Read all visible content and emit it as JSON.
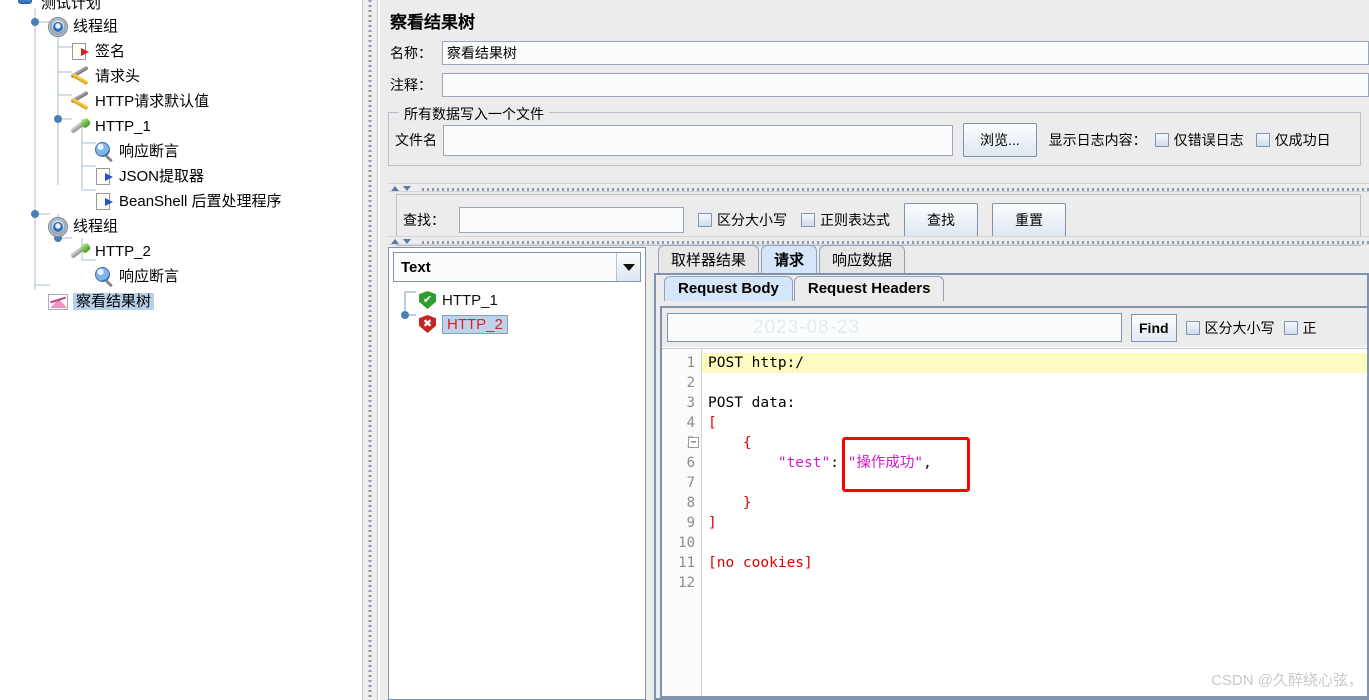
{
  "tree": {
    "name": "test-plan-tree",
    "nodes": [
      {
        "label": "测试计划",
        "icon": "test-plan-icon",
        "indent": 0,
        "selected": false,
        "clipped": true
      },
      {
        "label": "线程组",
        "icon": "thread-group-gear-icon",
        "indent": 1,
        "selected": false
      },
      {
        "label": "签名",
        "icon": "document-red-arrow-icon",
        "indent": 2,
        "selected": false
      },
      {
        "label": "请求头",
        "icon": "config-tools-icon",
        "indent": 2,
        "selected": false
      },
      {
        "label": "HTTP请求默认值",
        "icon": "config-tools-icon",
        "indent": 2,
        "selected": false
      },
      {
        "label": "HTTP_1",
        "icon": "http-sampler-icon",
        "indent": 2,
        "selected": false
      },
      {
        "label": "响应断言",
        "icon": "assertion-magnifier-icon",
        "indent": 3,
        "selected": false
      },
      {
        "label": "JSON提取器",
        "icon": "document-blue-arrow-icon",
        "indent": 3,
        "selected": false
      },
      {
        "label": "BeanShell 后置处理程序",
        "icon": "document-blue-arrow-icon",
        "indent": 3,
        "selected": false
      },
      {
        "label": "线程组",
        "icon": "thread-group-gear-icon",
        "indent": 1,
        "selected": false
      },
      {
        "label": "HTTP_2",
        "icon": "http-sampler-icon",
        "indent": 2,
        "selected": false
      },
      {
        "label": "响应断言",
        "icon": "assertion-magnifier-icon",
        "indent": 3,
        "selected": false
      },
      {
        "label": "察看结果树",
        "icon": "view-results-tree-icon",
        "indent": 1,
        "selected": true
      }
    ]
  },
  "main": {
    "title": "察看结果树",
    "name_label": "名称：",
    "name_value": "察看结果树",
    "comment_label": "注释：",
    "comment_value": "",
    "file_group": {
      "title": "所有数据写入一个文件",
      "filename_label": "文件名",
      "filename_value": "",
      "browse_label": "浏览...",
      "log_display_label": "显示日志内容：",
      "checkbox_errors_only": "仅错误日志",
      "checkbox_success_only": "仅成功日"
    },
    "search_strip": {
      "find_label": "查找：",
      "find_value": "",
      "checkbox_case": "区分大小写",
      "checkbox_regex": "正则表达式",
      "find_button": "查找",
      "reset_button": "重置"
    }
  },
  "results": {
    "renderer_selected": "Text",
    "items": [
      {
        "label": "HTTP_1",
        "status": "success",
        "status_glyph": "✔",
        "selected": false
      },
      {
        "label": "HTTP_2",
        "status": "error",
        "status_glyph": "✖",
        "selected": true
      }
    ]
  },
  "detail": {
    "tabs": [
      {
        "label": "取样器结果",
        "active": false
      },
      {
        "label": "请求",
        "active": true
      },
      {
        "label": "响应数据",
        "active": false
      }
    ],
    "subtabs": [
      {
        "label": "Request Body",
        "active": true
      },
      {
        "label": "Request Headers",
        "active": false
      }
    ],
    "findbar": {
      "value": "",
      "watermark": "2023-08-23",
      "find_button": "Find",
      "checkbox_case": "区分大小写",
      "checkbox_regex_partial": "正"
    },
    "code": {
      "line_numbers": [
        "1",
        "2",
        "3",
        "4",
        "5",
        "6",
        "7",
        "8",
        "9",
        "10",
        "11",
        "12"
      ],
      "fold_marker_line": 5,
      "highlight_line": 1,
      "lines": [
        {
          "n": 1,
          "tokens": [
            {
              "t": "POST http:/",
              "c": "plain"
            }
          ]
        },
        {
          "n": 2,
          "tokens": []
        },
        {
          "n": 3,
          "tokens": [
            {
              "t": "POST data:",
              "c": "plain"
            }
          ]
        },
        {
          "n": 4,
          "tokens": [
            {
              "t": "[",
              "c": "red"
            }
          ]
        },
        {
          "n": 5,
          "tokens": [
            {
              "t": "    ",
              "c": "plain"
            },
            {
              "t": "{",
              "c": "red"
            }
          ]
        },
        {
          "n": 6,
          "tokens": [
            {
              "t": "        ",
              "c": "plain"
            },
            {
              "t": "\"test\"",
              "c": "mag"
            },
            {
              "t": ": ",
              "c": "dark"
            },
            {
              "t": "\"操作成功\"",
              "c": "mag"
            },
            {
              "t": ",",
              "c": "dark"
            }
          ]
        },
        {
          "n": 7,
          "tokens": []
        },
        {
          "n": 8,
          "tokens": [
            {
              "t": "    ",
              "c": "plain"
            },
            {
              "t": "}",
              "c": "red"
            }
          ]
        },
        {
          "n": 9,
          "tokens": [
            {
              "t": "]",
              "c": "red"
            }
          ]
        },
        {
          "n": 10,
          "tokens": []
        },
        {
          "n": 11,
          "tokens": [
            {
              "t": "[no cookies]",
              "c": "red"
            }
          ]
        },
        {
          "n": 12,
          "tokens": []
        }
      ]
    }
  },
  "annotation": {
    "red_box_label": "highlight-operation-success"
  },
  "watermark": "CSDN @久醉绕心弦，",
  "colors": {
    "accent_blue": "#3b6ea5",
    "success_green": "#2f9e32",
    "error_red": "#c62424",
    "selected_text_red": "#e02020",
    "highlight_yellow": "#fdfbc0",
    "annotation_red": "#ff0000",
    "tab_active_blue": "#d6e6fa",
    "panel_gray": "#ececec"
  }
}
